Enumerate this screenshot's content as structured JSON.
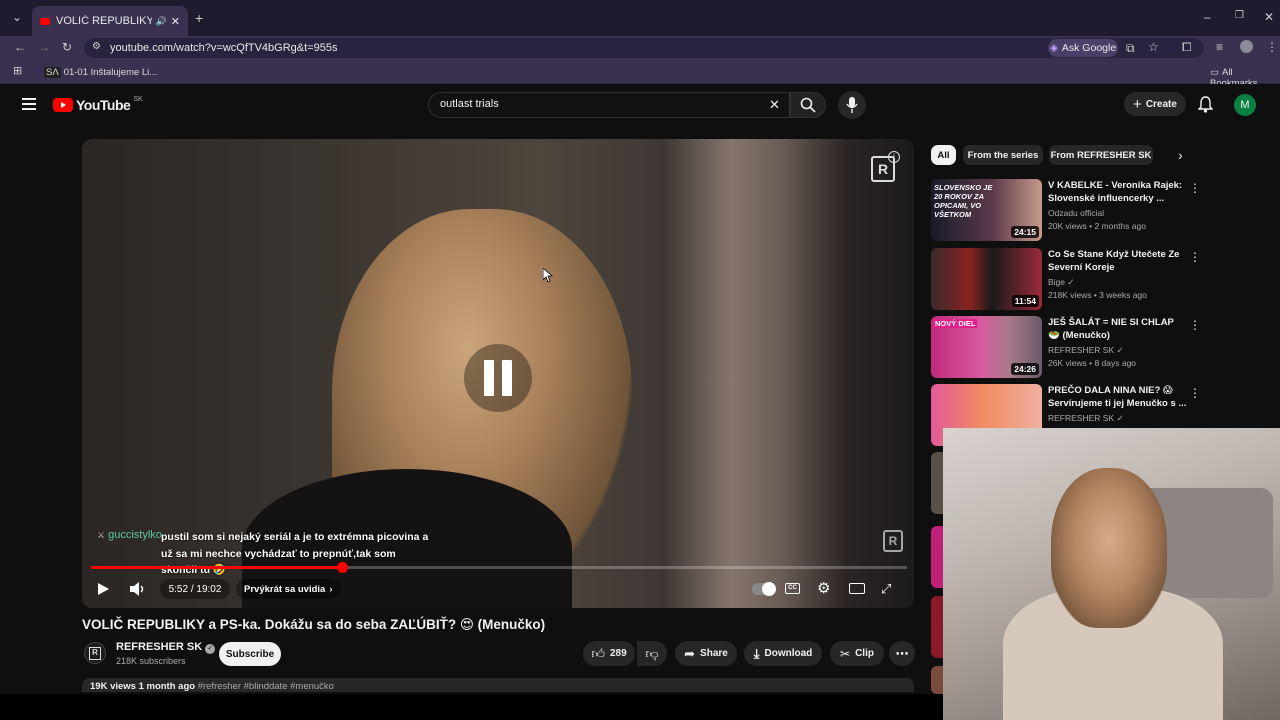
{
  "browser": {
    "tab_title": "VOLIČ REPUBLIKY a PS-ka. Dok",
    "url": "youtube.com/watch?v=wcQfTV4bGRg&t=955s",
    "ask_google": "Ask Google",
    "bookmark_item": "01-01 Inštalujeme Li...",
    "all_bookmarks": "All Bookmarks"
  },
  "youtube": {
    "logo_text": "YouTube",
    "region": "SK",
    "search_value": "outlast trials",
    "create_label": "Create",
    "avatar_letter": "M"
  },
  "video": {
    "chat_user": "guccistylko",
    "chat_message": "pustil som si nejaký seriál a je to extrémna picovina a už sa mi nechce vychádzať to prepnúť,tak som skončil tu 🤣",
    "time": "5:52 / 19:02",
    "chapter": "Prvýkrát sa uvidia",
    "progress_fraction": 0.308,
    "title": "VOLIČ REPUBLIKY a PS-ka. Dokážu sa do seba ZAĽÚBIŤ? 😍 (Menučko)",
    "channel": "REFRESHER SK",
    "subscribers": "218K subscribers",
    "subscribe_label": "Subscribe",
    "likes": "289",
    "share_label": "Share",
    "download_label": "Download",
    "clip_label": "Clip",
    "views_line": "19K views  1 month ago",
    "tags": "#refresher #blinddate #menučko"
  },
  "sidebar": {
    "chips": [
      "All",
      "From the series",
      "From REFRESHER SK"
    ],
    "items": [
      {
        "title": "V KABELKE - Veronika Rajek: Slovenské influencerky ...",
        "channel": "Odzadu official",
        "meta": "20K views • 2 months ago",
        "duration": "24:15",
        "thumb_text": "SLOVENSKO JE 20 ROKOV ZA OPICAMI, VO VŠETKOM"
      },
      {
        "title": "Co Se Stane Když Utečete Ze Severní Koreje",
        "channel": "Bige",
        "meta": "218K views • 3 weeks ago",
        "duration": "11:54",
        "thumb_text": ""
      },
      {
        "title": "JEŠ ŠALÁT = NIE SI CHLAP 🥗 (Menučko)",
        "channel": "REFRESHER SK",
        "meta": "26K views • 8 days ago",
        "duration": "24:26",
        "thumb_text": "NOVÝ DIEL"
      },
      {
        "title": "PREČO DALA NINA NIE? 😱 Servírujeme ti jej Menučko s ...",
        "channel": "REFRESHER SK",
        "meta": "",
        "duration": "",
        "thumb_text": ""
      }
    ]
  },
  "colors": {
    "accent_red": "#ff0000",
    "chrome_bg": "#3a3150",
    "yt_bg": "#0f0f0f"
  }
}
